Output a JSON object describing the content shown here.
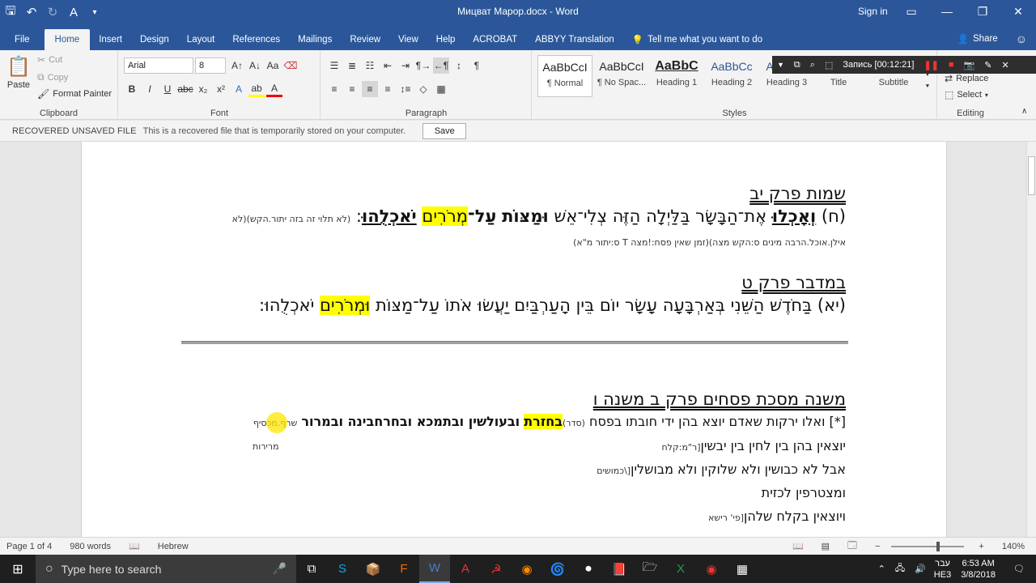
{
  "window": {
    "title": "Мицват Марор.docx - Word",
    "sign_in": "Sign in",
    "qat_icons": [
      "save-icon",
      "undo-icon",
      "redo-icon",
      "format-painter-icon",
      "customize-icon"
    ]
  },
  "tabs": [
    "File",
    "Home",
    "Insert",
    "Design",
    "Layout",
    "References",
    "Mailings",
    "Review",
    "View",
    "Help",
    "ACROBAT",
    "ABBYY Translation"
  ],
  "tell_me": "Tell me what you want to do",
  "share": "Share",
  "clipboard": {
    "paste": "Paste",
    "cut": "Cut",
    "copy": "Copy",
    "format_painter": "Format Painter",
    "label": "Clipboard"
  },
  "font": {
    "name": "Arial",
    "size": "8",
    "label": "Font"
  },
  "paragraph": {
    "label": "Paragraph"
  },
  "styles": {
    "label": "Styles",
    "items": [
      {
        "sample": "AaBbCcI",
        "name": "¶ Normal"
      },
      {
        "sample": "AaBbCcI",
        "name": "¶ No Spac..."
      },
      {
        "sample": "AaBbC",
        "name": "Heading 1"
      },
      {
        "sample": "AaBbCc",
        "name": "Heading 2"
      },
      {
        "sample": "AaBbCc",
        "name": "Heading 3"
      },
      {
        "sample": "",
        "name": "Title"
      },
      {
        "sample": "",
        "name": "Subtitle"
      }
    ]
  },
  "editing": {
    "replace": "Replace",
    "select": "Select",
    "label": "Editing"
  },
  "recorder": {
    "label": "Запись [00:12:21]"
  },
  "message_bar": {
    "title": "RECOVERED UNSAVED FILE",
    "text": "This is a recovered file that is temporarily stored on your computer.",
    "save": "Save"
  },
  "document": {
    "heading1": "שמות פרק יב",
    "verse1_ref": "(ח)",
    "verse1_a": "וְאָכְלוּ",
    "verse1_b": "אֶת־הַבָּשָׂר בַּלַּיְלָה הַזֶּה צְלִי־אֵשׁ",
    "verse1_c": "וּמַצּוֹת",
    "verse1_d": "עַל־",
    "verse1_e": "מְרֹרִים",
    "verse1_f": "יֹאכְלֻהוּ",
    "verse1_colon": ":",
    "verse1_note": "(לא תלוי זה בזה יתור.הקש)(לא",
    "note_line2": "אילן.אוכל.הרבה מינים ס:הקש מצה)(זמן שאין פסח:!מצה  T ס:יתור מ\"א)",
    "heading2": "במדבר פרק ט",
    "verse2_a": "(יא) בַּחֹדֶשׁ הַשֵּׁנִי בְּאַרְבָּעָה עָשָׂר יוֹם בֵּין הָעַרְבַּיִם יַעֲשׂוּ אֹתוֹ עַל־מַצּוֹת",
    "verse2_b": "וּמְרֹרִים",
    "verse2_c": "יֹאכְלֻהוּ:",
    "heading3": "משנה מסכת פסחים פרק ב משנה ו",
    "m1_a": "[*] ואלו ירקות שאדם יוצא בהן ידי חובתו בפסח",
    "m1_note": "(סדר)",
    "m1_b": "בחזרת",
    "m1_c": "ובעולשין ובתמכא ובחרחבינה ובמרור",
    "m1_side": "שרף.מכסיף",
    "m1_side2": "מרירות",
    "m2": "יוצאין בהן בין לחין בין יבשין",
    "m2_note": "[ר\"מ:קלח",
    "m3": "אבל לא כבושין ולא שלוקין ולא מבושלין",
    "m3_note": "[\\כמושים",
    "m4": "ומצטרפין לכזית",
    "m5": "ויוצאין בקלח שלהן",
    "m5_note": "[פי' רישא"
  },
  "status": {
    "page": "Page 1 of 4",
    "words": "980 words",
    "language": "Hebrew",
    "zoom": "140%"
  },
  "taskbar": {
    "search": "Type here to search",
    "lang": "עבר",
    "ime": "HE3",
    "time": "6:53 AM",
    "date": "3/8/2018"
  }
}
